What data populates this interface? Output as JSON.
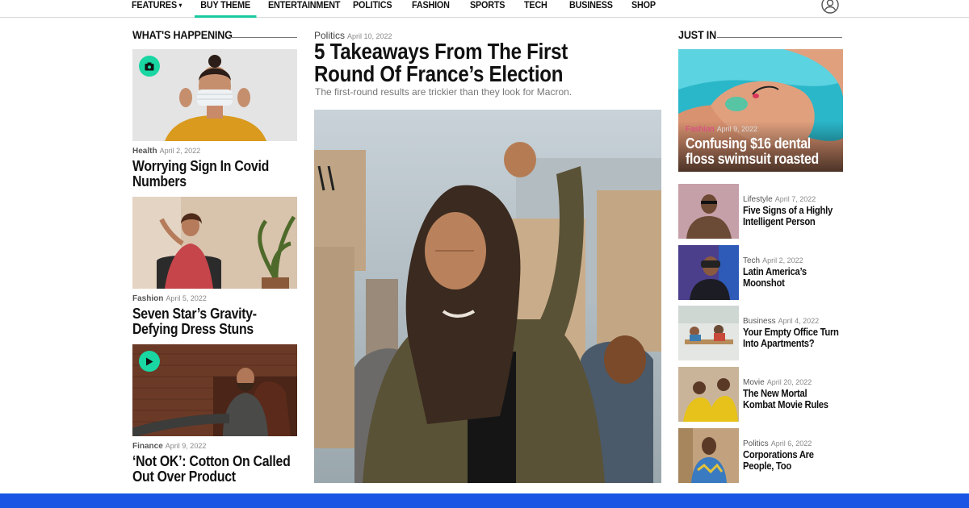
{
  "nav": {
    "items": [
      {
        "label": "FEATURES",
        "caret": "▾"
      },
      {
        "label": "BUY THEME"
      },
      {
        "label": "ENTERTAINMENT"
      },
      {
        "label": "POLITICS"
      },
      {
        "label": "FASHION"
      },
      {
        "label": "SPORTS"
      },
      {
        "label": "TECH"
      },
      {
        "label": "BUSINESS"
      },
      {
        "label": "SHOP"
      }
    ],
    "active_index": 1,
    "user_icon": "user-icon"
  },
  "whats_happening": {
    "title": "WHAT'S HAPPENING",
    "articles": [
      {
        "category": "Health",
        "date": "April 2, 2022",
        "title": "Worrying Sign In Covid Numbers",
        "badge_icon": "gallery-icon"
      },
      {
        "category": "Fashion",
        "date": "April 5, 2022",
        "title": "Seven Star’s Gravity-Defying Dress Stuns"
      },
      {
        "category": "Finance",
        "date": "April 9, 2022",
        "title": "‘Not OK’: Cotton On Called Out Over Product",
        "badge_icon": "play-icon"
      }
    ]
  },
  "featured": {
    "category": "Politics",
    "date": "April 10, 2022",
    "title": "5 Takeaways From The First Round Of France’s Election",
    "subtitle": "The first-round results are trickier than they look for Macron."
  },
  "just_in": {
    "title": "JUST IN",
    "top": {
      "category": "Fashion",
      "date": "April 9, 2022",
      "title": "Confusing $16 dental floss swimsuit roasted"
    },
    "items": [
      {
        "category": "Lifestyle",
        "date": "April 7, 2022",
        "title": "Five Signs of a Highly Intelligent Person"
      },
      {
        "category": "Tech",
        "date": "April 2, 2022",
        "title": "Latin America’s Moonshot"
      },
      {
        "category": "Business",
        "date": "April 4, 2022",
        "title": "Your Empty Office Turn Into Apartments?"
      },
      {
        "category": "Movie",
        "date": "April 20, 2022",
        "title": "The New Mortal Kombat Movie Rules"
      },
      {
        "category": "Politics",
        "date": "April 6, 2022",
        "title": "Corporations Are People, Too"
      }
    ]
  },
  "colors": {
    "accent": "#19c9a0",
    "footer_bar": "#1a55e3",
    "fashion_pink": "#e0428a"
  }
}
